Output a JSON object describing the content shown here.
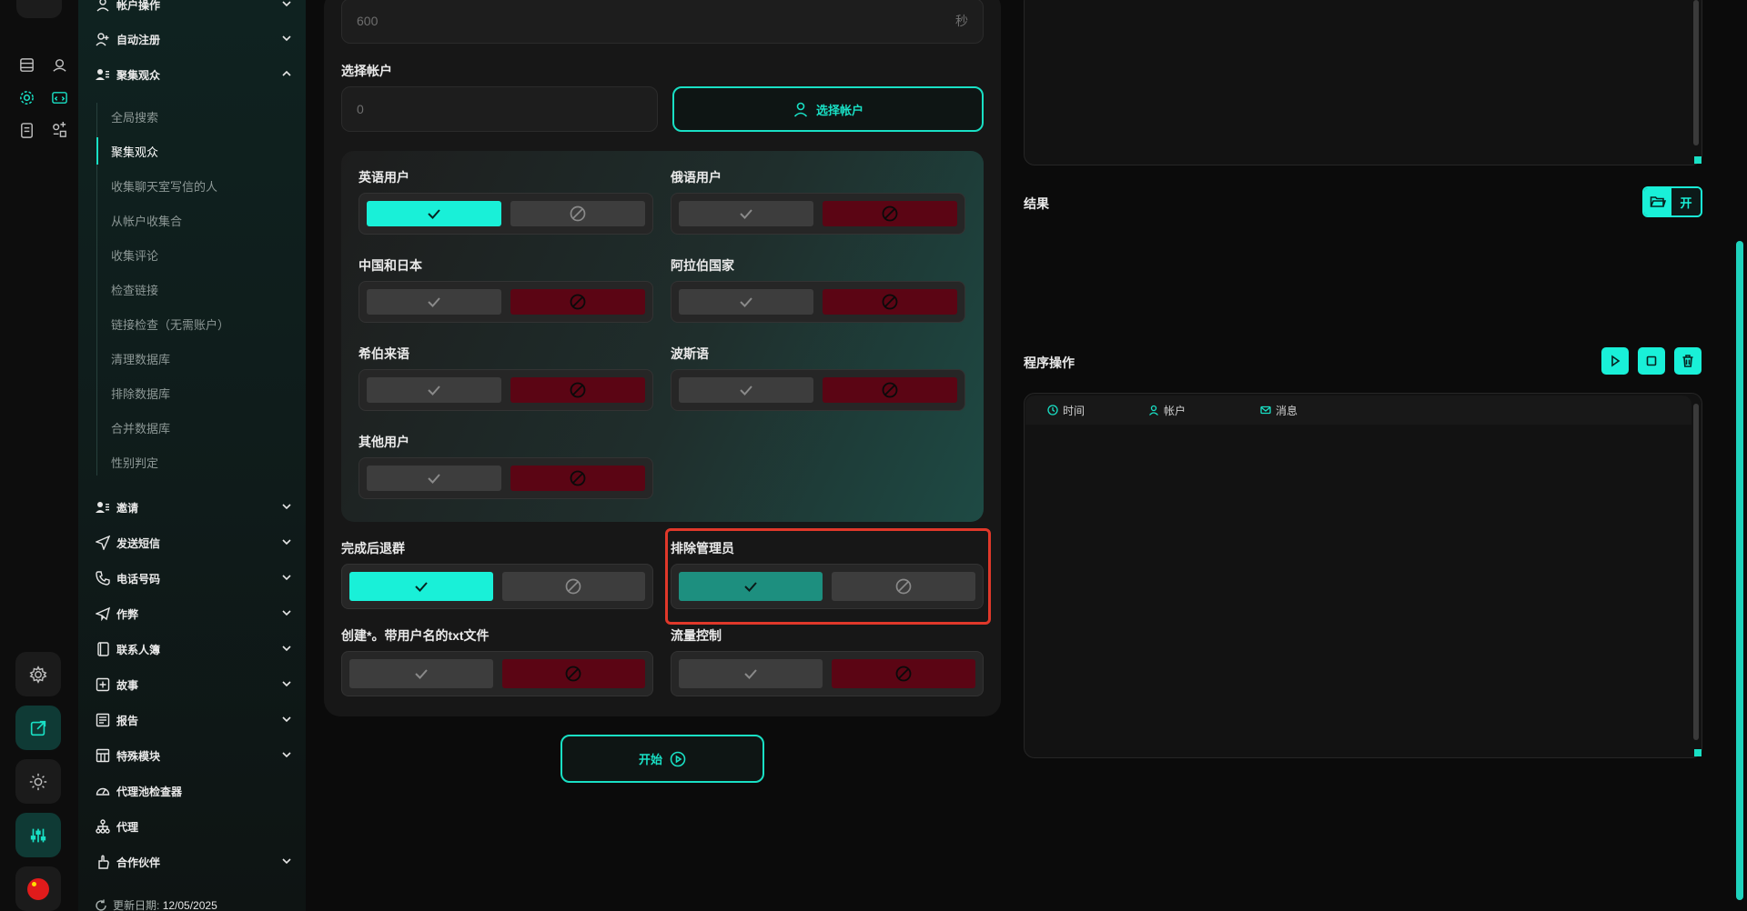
{
  "nav": {
    "items": [
      {
        "label": "帐户操作",
        "icon": "user-icon",
        "top": 0
      },
      {
        "label": "自动注册",
        "icon": "user-plus-icon"
      },
      {
        "label": "聚集观众",
        "icon": "users-icon"
      },
      {
        "label": "邀请",
        "icon": "users-icon"
      },
      {
        "label": "发送短信",
        "icon": "send-icon"
      },
      {
        "label": "电话号码",
        "icon": "phone-icon"
      },
      {
        "label": "作弊",
        "icon": "paper-plane-icon"
      },
      {
        "label": "联系人簿",
        "icon": "book-icon"
      },
      {
        "label": "故事",
        "icon": "plus-square-icon"
      },
      {
        "label": "报告",
        "icon": "report-icon"
      },
      {
        "label": "特殊模块",
        "icon": "grid-icon"
      },
      {
        "label": "代理池检查器",
        "icon": "gauge-icon"
      },
      {
        "label": "代理",
        "icon": "network-icon"
      },
      {
        "label": "合作伙伴",
        "icon": "hand-icon"
      }
    ],
    "sub_items": [
      "全局搜索",
      "聚集观众",
      "收集聊天室写信的人",
      "从帐户收集合",
      "收集评论",
      "检查链接",
      "链接检查（无需账户）",
      "清理数据库",
      "排除数据库",
      "合并数据库",
      "性别判定"
    ],
    "active_sub": "聚集观众",
    "update_label": "更新日期:",
    "update_date": "12/05/2025"
  },
  "form": {
    "delay_value": "600",
    "delay_unit": "秒",
    "select_accounts_label": "选择帐户",
    "accounts_value": "0",
    "select_accounts_button": "选择帐户",
    "filters": [
      {
        "label": "英语用户",
        "state": "on"
      },
      {
        "label": "俄语用户",
        "state": "off"
      },
      {
        "label": "中国和日本",
        "state": "off"
      },
      {
        "label": "阿拉伯国家",
        "state": "off"
      },
      {
        "label": "希伯来语",
        "state": "off"
      },
      {
        "label": "波斯语",
        "state": "off"
      },
      {
        "label": "其他用户",
        "state": "off"
      }
    ],
    "leave_group_label": "完成后退群",
    "exclude_admins_label": "排除管理员",
    "create_txt_label": "创建*。带用户名的txt文件",
    "traffic_control_label": "流量控制",
    "start_button": "开始"
  },
  "right": {
    "results_label": "结果",
    "open_button": "开",
    "program_ops_label": "程序操作",
    "columns": [
      "时间",
      "帐户",
      "消息"
    ]
  },
  "colors": {
    "accent": "#19f0d8",
    "ban_red": "#5b0514",
    "highlight": "#e0382a"
  }
}
